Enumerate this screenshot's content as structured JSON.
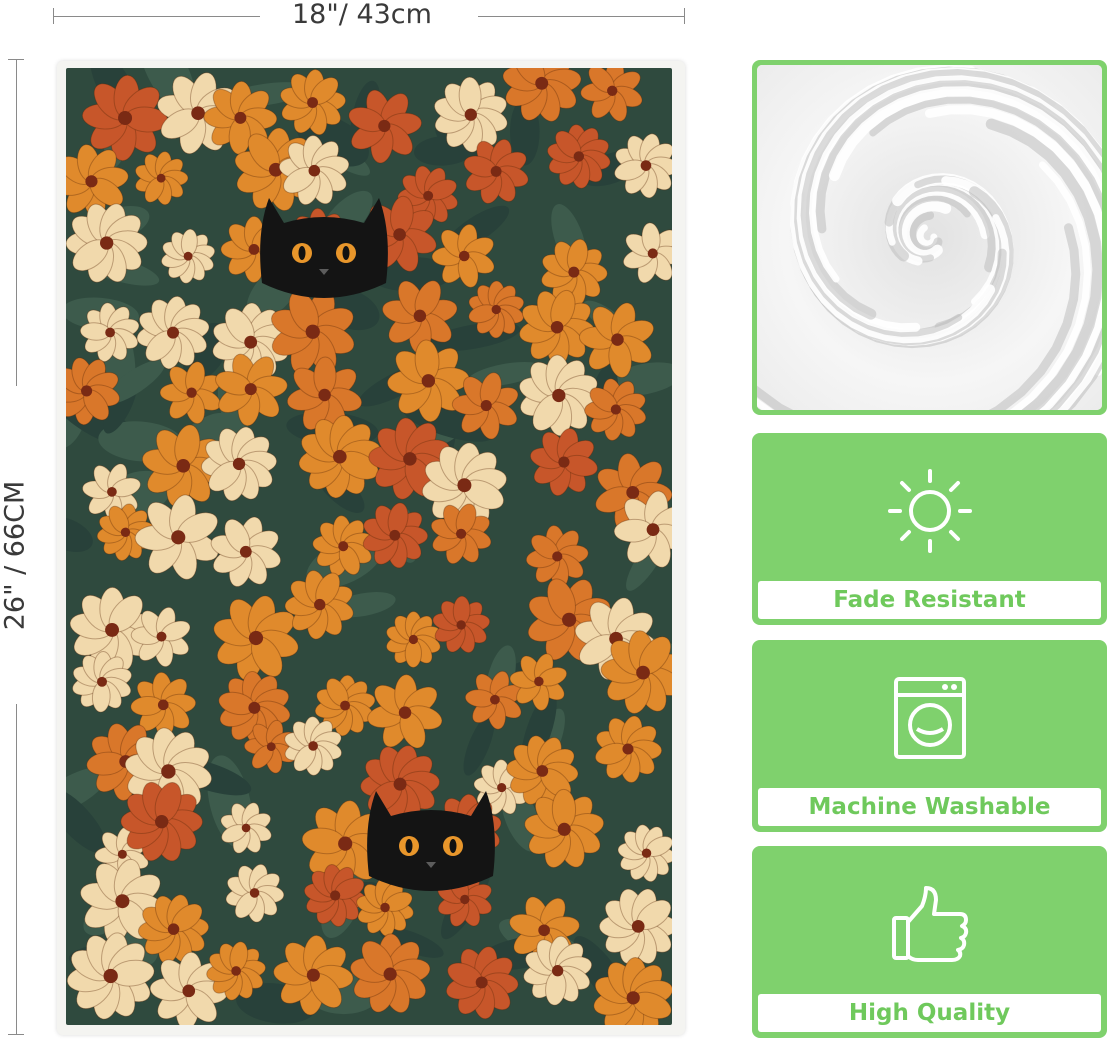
{
  "dimensions": {
    "width_label": "18\"/ 43cm",
    "height_label": "26\" / 66CM"
  },
  "product": {
    "print_pattern": "black cats peeking through orange, rust and cream flowers on dark green foliage",
    "colors": {
      "accent_green": "#7fd16d",
      "label_text_green": "#6fc95c",
      "foliage": "#2f4a3e",
      "orange": "#e08a2c",
      "rust": "#c7562a",
      "cream": "#f1d9ac",
      "flower_center": "#7a2a14",
      "cat": "#141414",
      "cat_eyes": "#e8962b"
    }
  },
  "features": [
    {
      "label": "Fade Resistant",
      "icon": "sun-icon"
    },
    {
      "label": "Machine Washable",
      "icon": "washing-machine-icon"
    },
    {
      "label": "High Quality",
      "icon": "thumbs-up-icon"
    }
  ],
  "fabric_closeup": {
    "icon": "towel-swirl-closeup"
  }
}
